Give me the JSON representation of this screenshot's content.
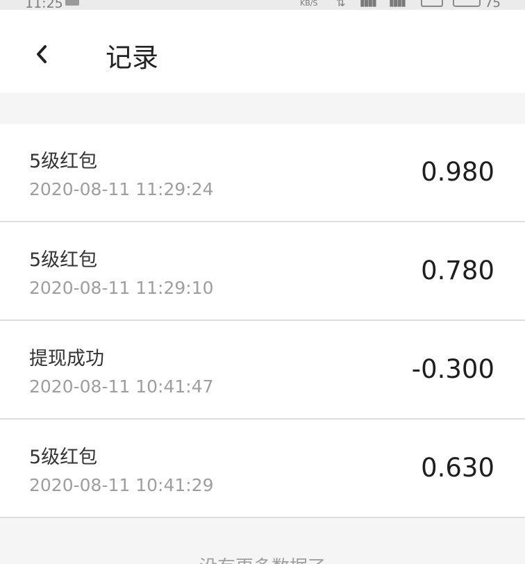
{
  "status_bar": {
    "time": "11:25",
    "net_speed": "KB/S",
    "battery_level": "75"
  },
  "header": {
    "title": "记录"
  },
  "records": [
    {
      "title": "5级红包",
      "time": "2020-08-11 11:29:24",
      "amount": "0.980"
    },
    {
      "title": "5级红包",
      "time": "2020-08-11 11:29:10",
      "amount": "0.780"
    },
    {
      "title": "提现成功",
      "time": "2020-08-11 10:41:47",
      "amount": "-0.300"
    },
    {
      "title": "5级红包",
      "time": "2020-08-11 10:41:29",
      "amount": "0.630"
    }
  ],
  "footer": {
    "end_text": "没有更多数据了"
  }
}
